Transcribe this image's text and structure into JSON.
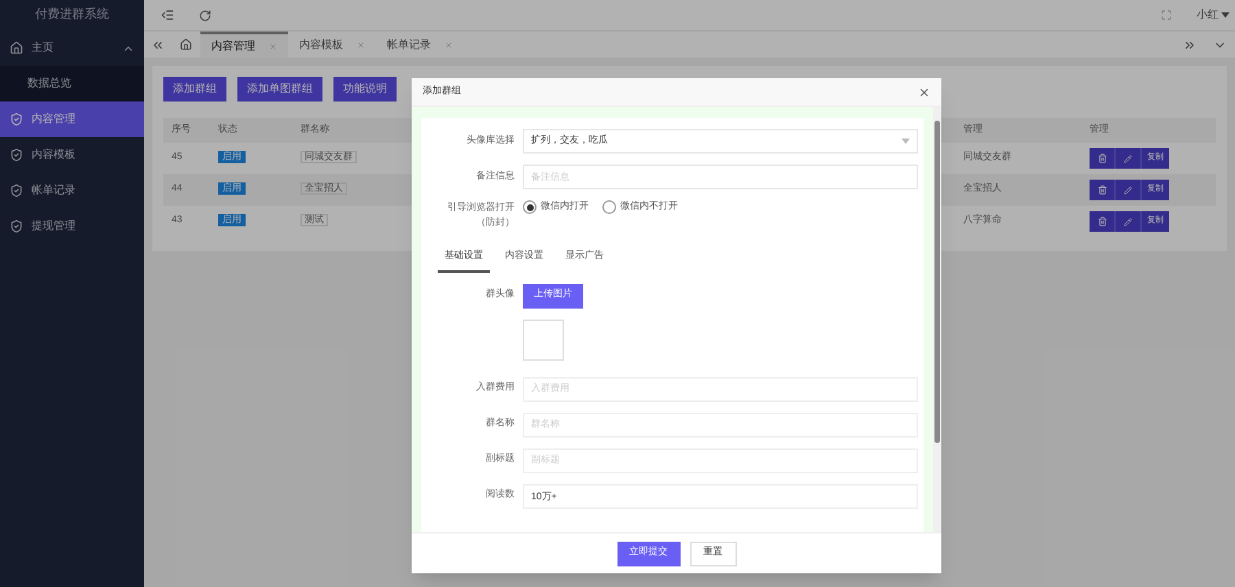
{
  "sidebar": {
    "title": "付费进群系统",
    "items": [
      {
        "label": "主页",
        "kind": "home",
        "expanded": true,
        "selected": false,
        "children": [
          {
            "label": "数据总览",
            "selected": false
          }
        ]
      },
      {
        "label": "内容管理",
        "kind": "shield",
        "selected": true
      },
      {
        "label": "内容模板",
        "kind": "shield",
        "selected": false
      },
      {
        "label": "帐单记录",
        "kind": "shield",
        "selected": false
      },
      {
        "label": "提现管理",
        "kind": "shield",
        "selected": false
      }
    ]
  },
  "topbar": {
    "user": "小红"
  },
  "tabs": [
    {
      "label": "内容管理",
      "selected": true
    },
    {
      "label": "内容模板",
      "selected": false
    },
    {
      "label": "帐单记录",
      "selected": false
    }
  ],
  "toolbar": [
    "添加群组",
    "添加单图群组",
    "功能说明"
  ],
  "table": {
    "columns": [
      "序号",
      "状态",
      "群名称",
      "管理",
      "管理"
    ],
    "rows": [
      {
        "id": "45",
        "status": "启用",
        "name": "同城交友群",
        "column_4": "同城交友群",
        "action": "复制"
      },
      {
        "id": "44",
        "status": "启用",
        "name": "全宝招人",
        "column_4": "全宝招人",
        "action": "复制"
      },
      {
        "id": "43",
        "status": "启用",
        "name": "测试",
        "column_4": "八字算命",
        "action": "复制"
      }
    ]
  },
  "dialog": {
    "title": "添加群组",
    "avatar_library": {
      "label": "头像库选择",
      "value": "扩列，交友，吃瓜"
    },
    "remark": {
      "label": "备注信息",
      "placeholder": "备注信息"
    },
    "browser": {
      "label": "引导浏览器打开（防封）",
      "options": [
        {
          "label": "微信内打开",
          "selected": true
        },
        {
          "label": "微信内不打开",
          "selected": false
        }
      ]
    },
    "tabs": [
      {
        "label": "基础设置",
        "selected": true
      },
      {
        "label": "内容设置",
        "selected": false
      },
      {
        "label": "显示广告",
        "selected": false
      }
    ],
    "group_avatar": {
      "label": "群头像",
      "button": "上传图片"
    },
    "fields": [
      {
        "label": "入群费用",
        "placeholder": "入群费用"
      },
      {
        "label": "群名称",
        "placeholder": "群名称"
      },
      {
        "label": "副标题",
        "placeholder": "副标题"
      },
      {
        "label": "阅读数",
        "value": "10万+"
      }
    ],
    "buttons": [
      {
        "label": "立即提交",
        "kind": "primary"
      },
      {
        "label": "重置",
        "kind": "plain"
      }
    ]
  }
}
